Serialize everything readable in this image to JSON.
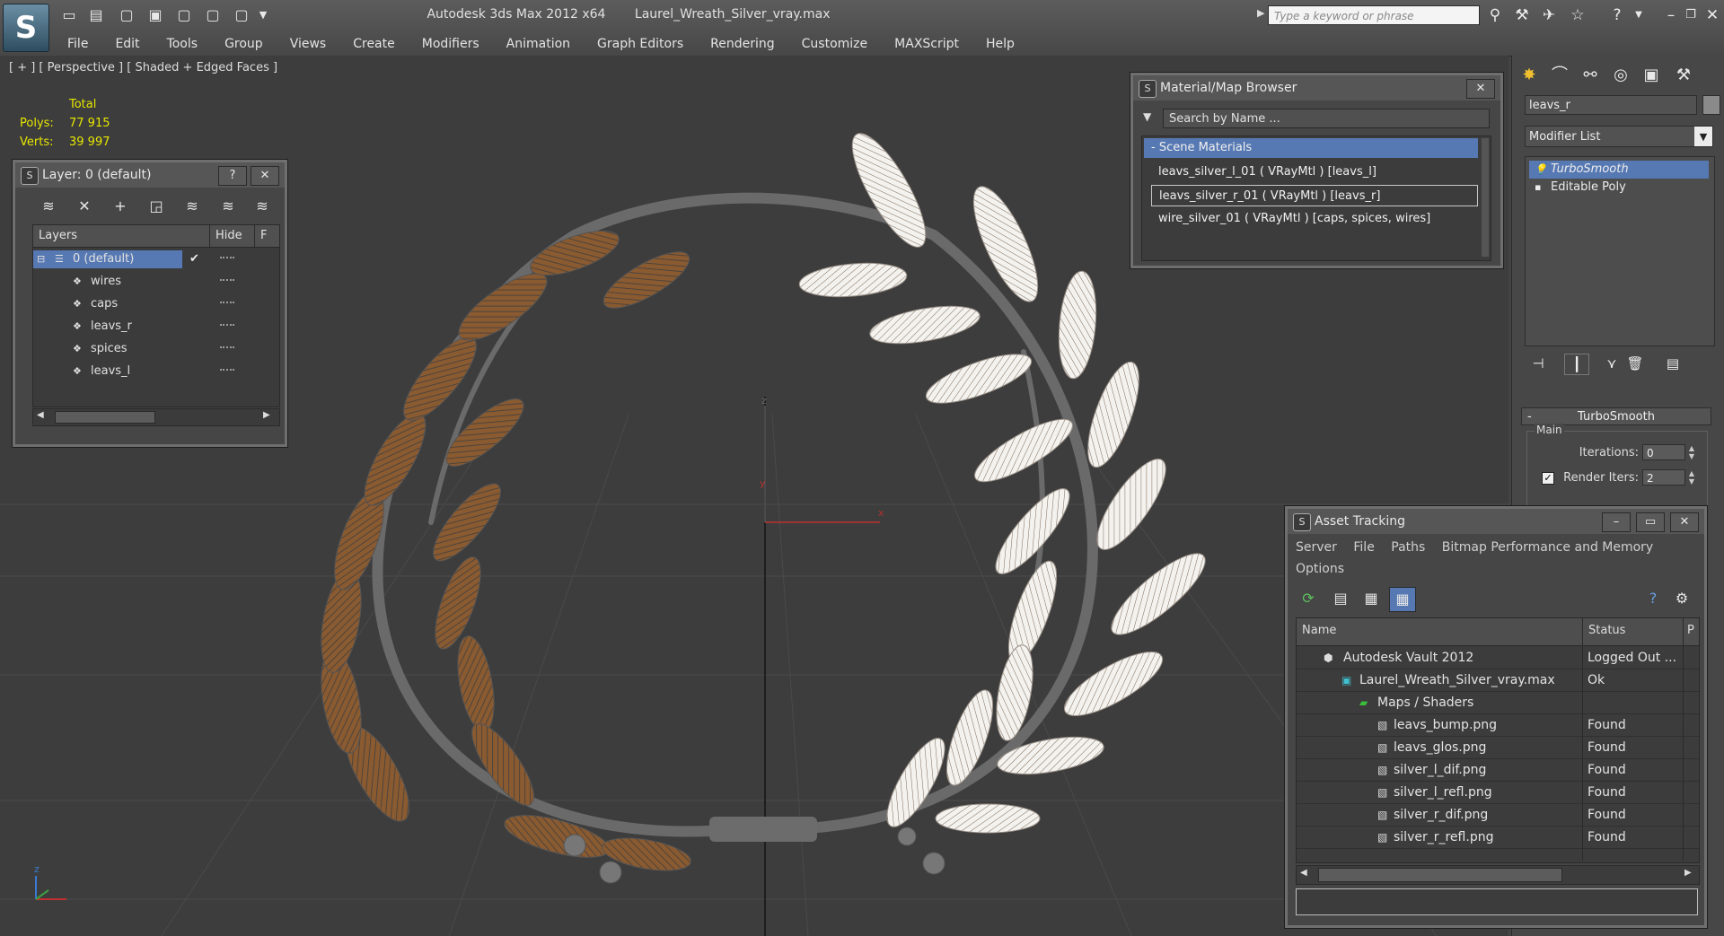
{
  "window": {
    "app_title": "Autodesk 3ds Max  2012 x64",
    "file_title": "Laurel_Wreath_Silver_vray.max",
    "search_placeholder": "Type a keyword or phrase"
  },
  "menu": [
    "File",
    "Edit",
    "Tools",
    "Group",
    "Views",
    "Create",
    "Modifiers",
    "Animation",
    "Graph Editors",
    "Rendering",
    "Customize",
    "MAXScript",
    "Help"
  ],
  "viewport": {
    "label": "[ + ] [ Perspective ] [ Shaded + Edged Faces ]",
    "stats": {
      "total_label": "Total",
      "polys_label": "Polys:",
      "polys_value": "77 915",
      "verts_label": "Verts:",
      "verts_value": "39 997"
    },
    "axis_x": "x",
    "axis_y": "y",
    "axis_z": "z"
  },
  "layer_window": {
    "title": "Layer: 0 (default)",
    "help_btn": "?",
    "close_btn": "✕",
    "col_layers": "Layers",
    "col_hide": "Hide",
    "col_f": "F",
    "layers": [
      {
        "name": "0 (default)",
        "checked": "✔"
      },
      {
        "name": "wires"
      },
      {
        "name": "caps"
      },
      {
        "name": "leavs_r"
      },
      {
        "name": "spices"
      },
      {
        "name": "leavs_l"
      }
    ]
  },
  "material_browser": {
    "title": "Material/Map Browser",
    "search_placeholder": "Search by Name ...",
    "group": "- Scene Materials",
    "materials": [
      "leavs_silver_l_01  ( VRayMtl ) [leavs_l]",
      "leavs_silver_r_01  ( VRayMtl ) [leavs_r]",
      "wire_silver_01  ( VRayMtl ) [caps, spices, wires]"
    ]
  },
  "command_panel": {
    "object_name": "leavs_r",
    "modifier_list": "Modifier List",
    "stack": [
      "TurboSmooth",
      "Editable Poly"
    ],
    "rollout_title": "TurboSmooth",
    "group_main": "Main",
    "iterations_label": "Iterations:",
    "iterations_value": "0",
    "render_iters_label": "Render Iters:",
    "render_iters_value": "2"
  },
  "asset_tracking": {
    "title": "Asset Tracking",
    "menu": [
      "Server",
      "File",
      "Paths",
      "Bitmap Performance and Memory",
      "Options"
    ],
    "col_name": "Name",
    "col_status": "Status",
    "col_p": "P",
    "rows": [
      {
        "name": "Autodesk Vault 2012",
        "status": "Logged Out ..."
      },
      {
        "name": "Laurel_Wreath_Silver_vray.max",
        "status": "Ok"
      },
      {
        "name": "Maps / Shaders",
        "status": ""
      },
      {
        "name": "leavs_bump.png",
        "status": "Found"
      },
      {
        "name": "leavs_glos.png",
        "status": "Found"
      },
      {
        "name": "silver_l_dif.png",
        "status": "Found"
      },
      {
        "name": "silver_l_refl.png",
        "status": "Found"
      },
      {
        "name": "silver_r_dif.png",
        "status": "Found"
      },
      {
        "name": "silver_r_refl.png",
        "status": "Found"
      }
    ]
  },
  "colors": {
    "selection_blue": "#5779b3",
    "stats_yellow": "#e6e600",
    "leaf_brown": "#8a5a30",
    "leaf_white": "#f4f2ee",
    "wire_gray": "#6a6a6a"
  }
}
